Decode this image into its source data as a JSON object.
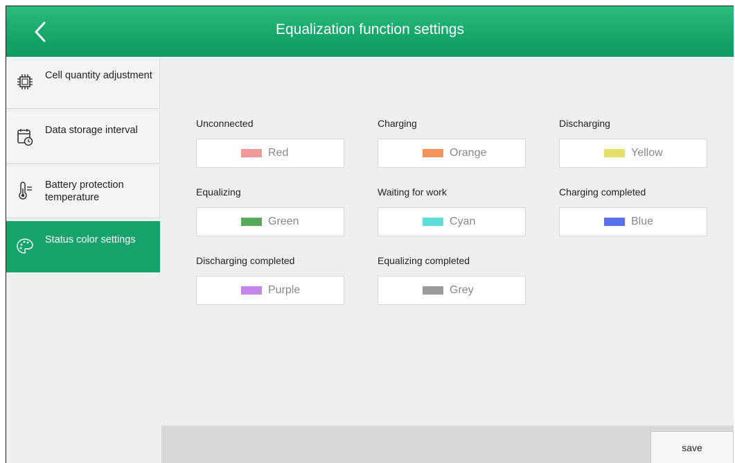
{
  "header": {
    "title": "Equalization function settings",
    "back_icon": "chevron-left-icon"
  },
  "sidebar": {
    "items": [
      {
        "label": "Cell quantity adjustment",
        "icon": "chip-icon",
        "active": false
      },
      {
        "label": "Data storage interval",
        "icon": "calendar-clock-icon",
        "active": false
      },
      {
        "label": "Battery protection temperature",
        "icon": "thermometer-icon",
        "active": false
      },
      {
        "label": "Status color settings",
        "icon": "palette-icon",
        "active": true
      }
    ]
  },
  "status_colors": [
    {
      "label": "Unconnected",
      "color_name": "Red",
      "swatch": "#ef9a9a"
    },
    {
      "label": "Charging",
      "color_name": "Orange",
      "swatch": "#f4935a"
    },
    {
      "label": "Discharging",
      "color_name": "Yellow",
      "swatch": "#e6e06a"
    },
    {
      "label": "Equalizing",
      "color_name": "Green",
      "swatch": "#5aa85c"
    },
    {
      "label": "Waiting for work",
      "color_name": "Cyan",
      "swatch": "#5fdcdc"
    },
    {
      "label": "Charging completed",
      "color_name": "Blue",
      "swatch": "#5870ec"
    },
    {
      "label": "Discharging completed",
      "color_name": "Purple",
      "swatch": "#c486ec"
    },
    {
      "label": "Equalizing completed",
      "color_name": "Grey",
      "swatch": "#9a9a9a"
    }
  ],
  "footer": {
    "save_label": "save"
  },
  "colors": {
    "accent": "#14a36a",
    "header_gradient_top": "#2bbc7e",
    "header_gradient_bottom": "#0e9b62"
  }
}
